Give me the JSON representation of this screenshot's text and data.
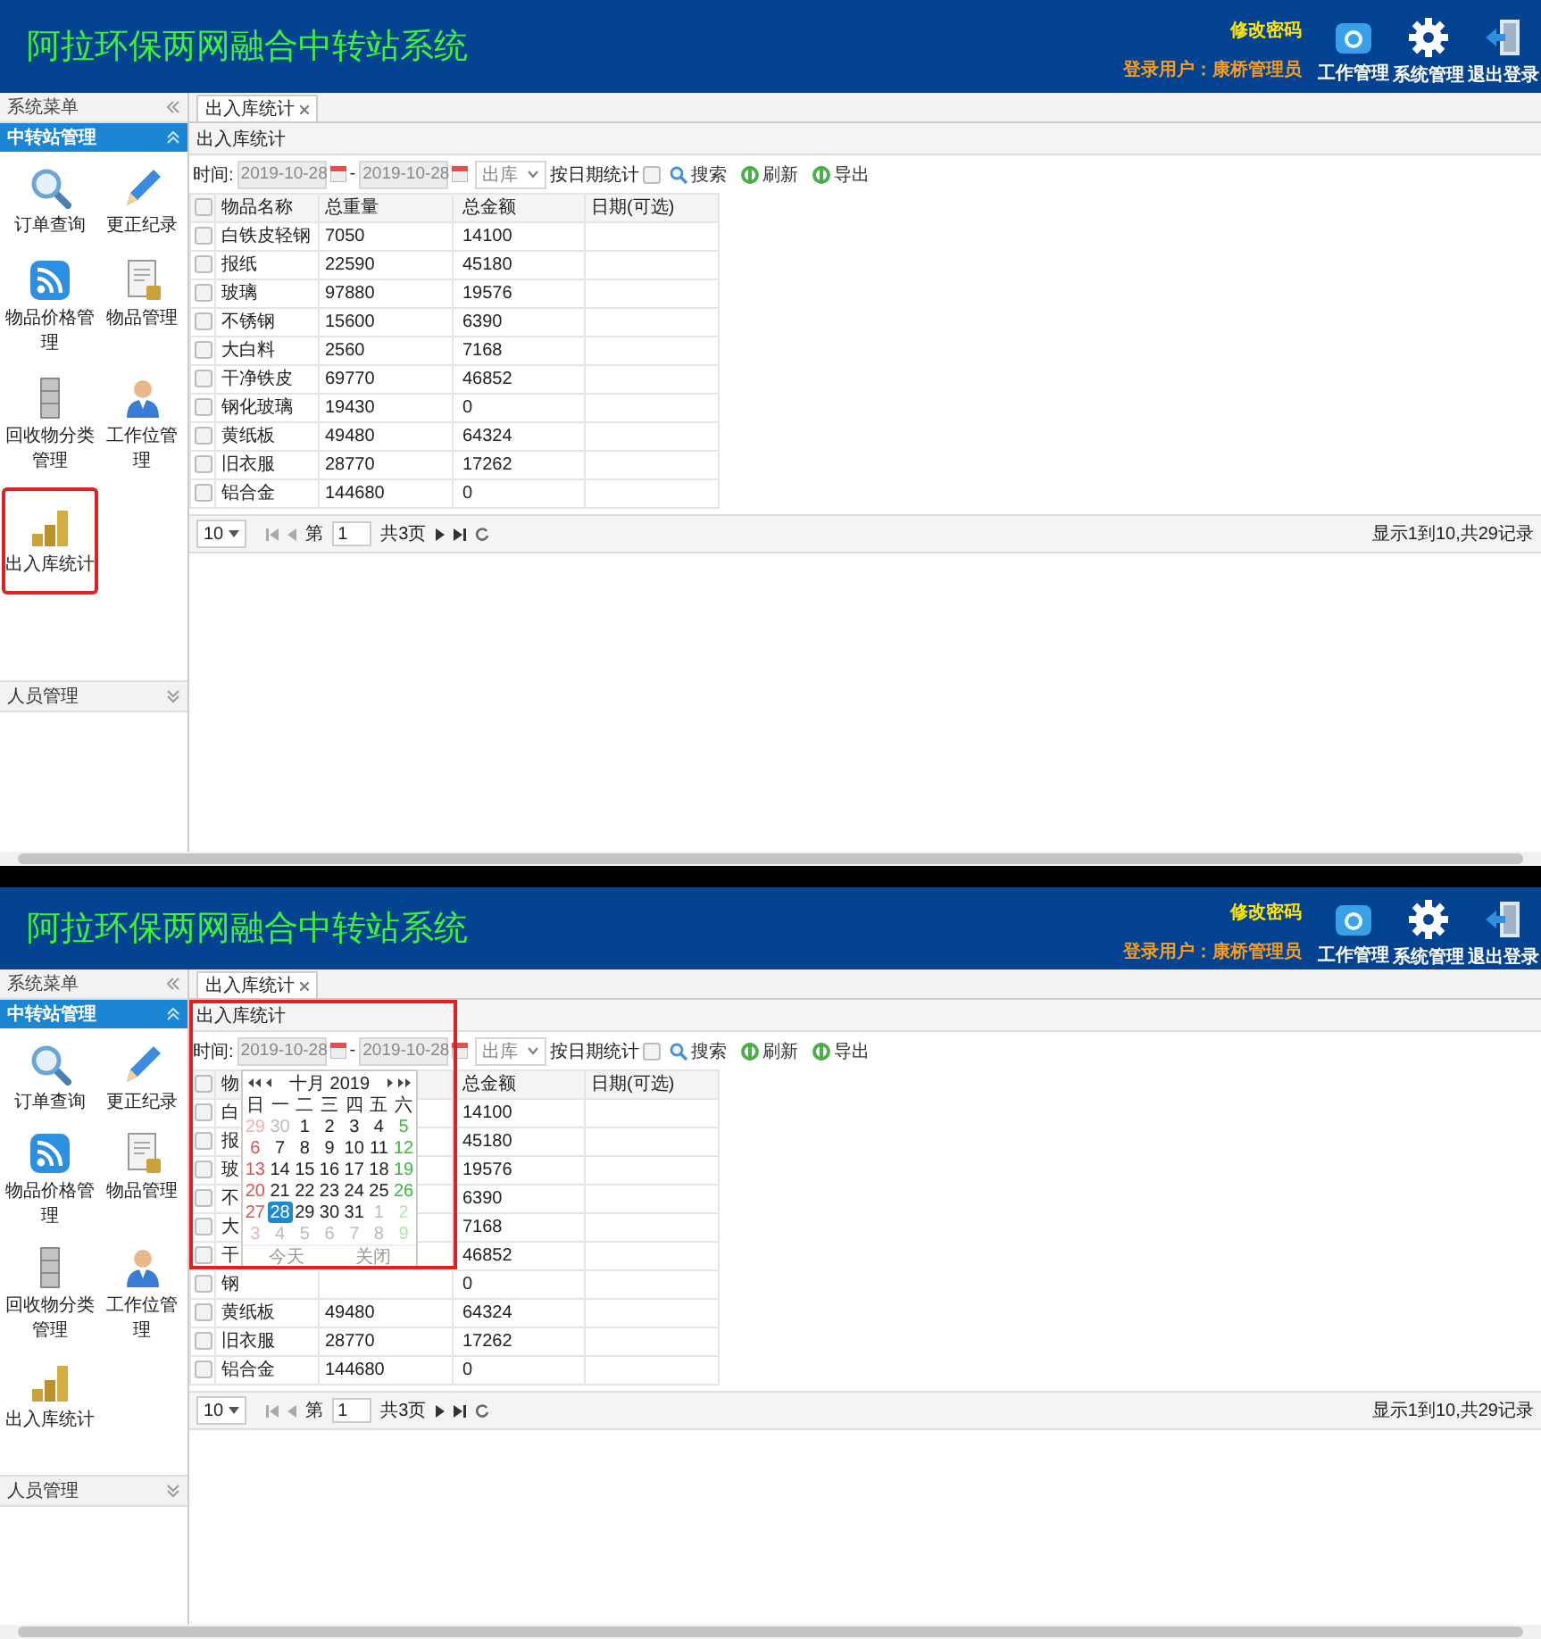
{
  "screens": [
    {
      "header": {
        "title": "阿拉环保两网融合中转站系统",
        "change_password": "修改密码",
        "login_user": "登录用户：康桥管理员",
        "actions": [
          {
            "kind": "work",
            "label": "工作管理"
          },
          {
            "kind": "settings",
            "label": "系统管理"
          },
          {
            "kind": "logout",
            "label": "退出登录"
          }
        ]
      },
      "sidebar": {
        "title": "系统菜单",
        "groups": [
          {
            "title": "中转站管理",
            "expanded": true,
            "items": [
              {
                "kind": "search",
                "label": "订单查询",
                "highlighted": false
              },
              {
                "kind": "edit",
                "label": "更正纪录",
                "highlighted": false
              },
              {
                "kind": "feed",
                "label": "物品价格管理",
                "highlighted": false
              },
              {
                "kind": "document",
                "label": "物品管理",
                "highlighted": false
              },
              {
                "kind": "cabinet",
                "label": "回收物分类管理",
                "highlighted": false
              },
              {
                "kind": "person",
                "label": "工作位管理",
                "highlighted": false
              },
              {
                "kind": "coins",
                "label": "出入库统计",
                "highlighted": true
              }
            ]
          },
          {
            "title": "人员管理",
            "expanded": false
          }
        ]
      },
      "tabs": [
        {
          "label": "出入库统计",
          "selected": true
        }
      ],
      "panel": {
        "title": "出入库统计",
        "toolbar": {
          "label": "时间:",
          "start": "2019-10-28",
          "separator": "-",
          "end": "2019-10-28",
          "direction": "出库",
          "by_date_label": "按日期统计",
          "by_date": false,
          "buttons": [
            {
              "kind": "search",
              "label": "搜索"
            },
            {
              "kind": "refresh",
              "label": "刷新"
            },
            {
              "kind": "export",
              "label": "导出"
            }
          ]
        },
        "table": {
          "all_checked": false,
          "columns": [
            {
              "label": "物品名称"
            },
            {
              "label": "总重量"
            },
            {
              "label": "总金额"
            },
            {
              "label": "日期(可选)"
            }
          ],
          "rows": [
            {
              "name": "白铁皮轻钢",
              "weight": "7050",
              "amount": "14100",
              "checked": false
            },
            {
              "name": "报纸",
              "weight": "22590",
              "amount": "45180",
              "checked": false
            },
            {
              "name": "玻璃",
              "weight": "97880",
              "amount": "19576",
              "checked": false
            },
            {
              "name": "不锈钢",
              "weight": "15600",
              "amount": "6390",
              "checked": false
            },
            {
              "name": "大白料",
              "weight": "2560",
              "amount": "7168",
              "checked": false
            },
            {
              "name": "干净铁皮",
              "weight": "69770",
              "amount": "46852",
              "checked": false
            },
            {
              "name": "钢化玻璃",
              "weight": "19430",
              "amount": "0",
              "checked": false
            },
            {
              "name": "黄纸板",
              "weight": "49480",
              "amount": "64324",
              "checked": false
            },
            {
              "name": "旧衣服",
              "weight": "28770",
              "amount": "17262",
              "checked": false
            },
            {
              "name": "铝合金",
              "weight": "144680",
              "amount": "0",
              "checked": false
            }
          ]
        },
        "pager": {
          "page_size": "10",
          "page_label": "第",
          "page": "1",
          "total_pages": "共3页",
          "summary": "显示1到10,共29记录"
        }
      }
    },
    {
      "header": {
        "title": "阿拉环保两网融合中转站系统",
        "change_password": "修改密码",
        "login_user": "登录用户：康桥管理员",
        "actions": [
          {
            "kind": "work",
            "label": "工作管理"
          },
          {
            "kind": "settings",
            "label": "系统管理"
          },
          {
            "kind": "logout",
            "label": "退出登录"
          }
        ]
      },
      "sidebar": {
        "title": "系统菜单",
        "groups": [
          {
            "title": "中转站管理",
            "expanded": true,
            "items": [
              {
                "kind": "search",
                "label": "订单查询",
                "highlighted": false
              },
              {
                "kind": "edit",
                "label": "更正纪录",
                "highlighted": false
              },
              {
                "kind": "feed",
                "label": "物品价格管理",
                "highlighted": false
              },
              {
                "kind": "document",
                "label": "物品管理",
                "highlighted": false
              },
              {
                "kind": "cabinet",
                "label": "回收物分类管理",
                "highlighted": false
              },
              {
                "kind": "person",
                "label": "工作位管理",
                "highlighted": false
              },
              {
                "kind": "coins",
                "label": "出入库统计",
                "highlighted": false
              }
            ]
          },
          {
            "title": "人员管理",
            "expanded": false
          }
        ]
      },
      "tabs": [
        {
          "label": "出入库统计",
          "selected": true
        }
      ],
      "panel": {
        "title": "出入库统计",
        "toolbar": {
          "label": "时间:",
          "start": "2019-10-28",
          "separator": "-",
          "end": "2019-10-28",
          "direction": "出库",
          "by_date_label": "按日期统计",
          "by_date": false,
          "buttons": [
            {
              "kind": "search",
              "label": "搜索"
            },
            {
              "kind": "refresh",
              "label": "刷新"
            },
            {
              "kind": "export",
              "label": "导出"
            }
          ]
        },
        "table": {
          "all_checked": false,
          "columns": [
            {
              "label": "物"
            },
            {},
            {
              "label": "总金额"
            },
            {
              "label": "日期(可选)"
            }
          ],
          "rows": [
            {
              "name": "白",
              "amount": "14100",
              "checked": false
            },
            {
              "name": "报",
              "amount": "45180",
              "checked": false
            },
            {
              "name": "玻",
              "amount": "19576",
              "checked": false
            },
            {
              "name": "不",
              "amount": "6390",
              "checked": false
            },
            {
              "name": "大",
              "amount": "7168",
              "checked": false
            },
            {
              "name": "干",
              "amount": "46852",
              "checked": false
            },
            {
              "name": "钢",
              "amount": "0",
              "checked": false
            },
            {
              "name": "黄纸板",
              "weight": "49480",
              "amount": "64324",
              "checked": false
            },
            {
              "name": "旧衣服",
              "weight": "28770",
              "amount": "17262",
              "checked": false
            },
            {
              "name": "铝合金",
              "weight": "144680",
              "amount": "0",
              "checked": false
            }
          ]
        },
        "pager": {
          "page_size": "10",
          "page_label": "第",
          "page": "1",
          "total_pages": "共3页",
          "summary": "显示1到10,共29记录"
        }
      },
      "calendar": {
        "month_label": "十月 2019",
        "weekdays": [
          "日",
          "一",
          "二",
          "三",
          "四",
          "五",
          "六"
        ],
        "weeks": [
          [
            {
              "day": "29",
              "other_month": true,
              "selected": false
            },
            {
              "day": "30",
              "other_month": true,
              "selected": false
            },
            {
              "day": "1",
              "other_month": false,
              "selected": false
            },
            {
              "day": "2",
              "other_month": false,
              "selected": false
            },
            {
              "day": "3",
              "other_month": false,
              "selected": false
            },
            {
              "day": "4",
              "other_month": false,
              "selected": false
            },
            {
              "day": "5",
              "other_month": false,
              "selected": false
            }
          ],
          [
            {
              "day": "6",
              "other_month": false,
              "selected": false
            },
            {
              "day": "7",
              "other_month": false,
              "selected": false
            },
            {
              "day": "8",
              "other_month": false,
              "selected": false
            },
            {
              "day": "9",
              "other_month": false,
              "selected": false
            },
            {
              "day": "10",
              "other_month": false,
              "selected": false
            },
            {
              "day": "11",
              "other_month": false,
              "selected": false
            },
            {
              "day": "12",
              "other_month": false,
              "selected": false
            }
          ],
          [
            {
              "day": "13",
              "other_month": false,
              "selected": false
            },
            {
              "day": "14",
              "other_month": false,
              "selected": false
            },
            {
              "day": "15",
              "other_month": false,
              "selected": false
            },
            {
              "day": "16",
              "other_month": false,
              "selected": false
            },
            {
              "day": "17",
              "other_month": false,
              "selected": false
            },
            {
              "day": "18",
              "other_month": false,
              "selected": false
            },
            {
              "day": "19",
              "other_month": false,
              "selected": false
            }
          ],
          [
            {
              "day": "20",
              "other_month": false,
              "selected": false
            },
            {
              "day": "21",
              "other_month": false,
              "selected": false
            },
            {
              "day": "22",
              "other_month": false,
              "selected": false
            },
            {
              "day": "23",
              "other_month": false,
              "selected": false
            },
            {
              "day": "24",
              "other_month": false,
              "selected": false
            },
            {
              "day": "25",
              "other_month": false,
              "selected": false
            },
            {
              "day": "26",
              "other_month": false,
              "selected": false
            }
          ],
          [
            {
              "day": "27",
              "other_month": false,
              "selected": false
            },
            {
              "day": "28",
              "other_month": false,
              "selected": true
            },
            {
              "day": "29",
              "other_month": false,
              "selected": false
            },
            {
              "day": "30",
              "other_month": false,
              "selected": false
            },
            {
              "day": "31",
              "other_month": false,
              "selected": false
            },
            {
              "day": "1",
              "other_month": true,
              "selected": false
            },
            {
              "day": "2",
              "other_month": true,
              "selected": false
            }
          ],
          [
            {
              "day": "3",
              "other_month": true,
              "selected": false
            },
            {
              "day": "4",
              "other_month": true,
              "selected": false
            },
            {
              "day": "5",
              "other_month": true,
              "selected": false
            },
            {
              "day": "6",
              "other_month": true,
              "selected": false
            },
            {
              "day": "7",
              "other_month": true,
              "selected": false
            },
            {
              "day": "8",
              "other_month": true,
              "selected": false
            },
            {
              "day": "9",
              "other_month": true,
              "selected": false
            }
          ]
        ],
        "today": "今天",
        "close": "关闭"
      },
      "annotation_frame": true
    }
  ]
}
